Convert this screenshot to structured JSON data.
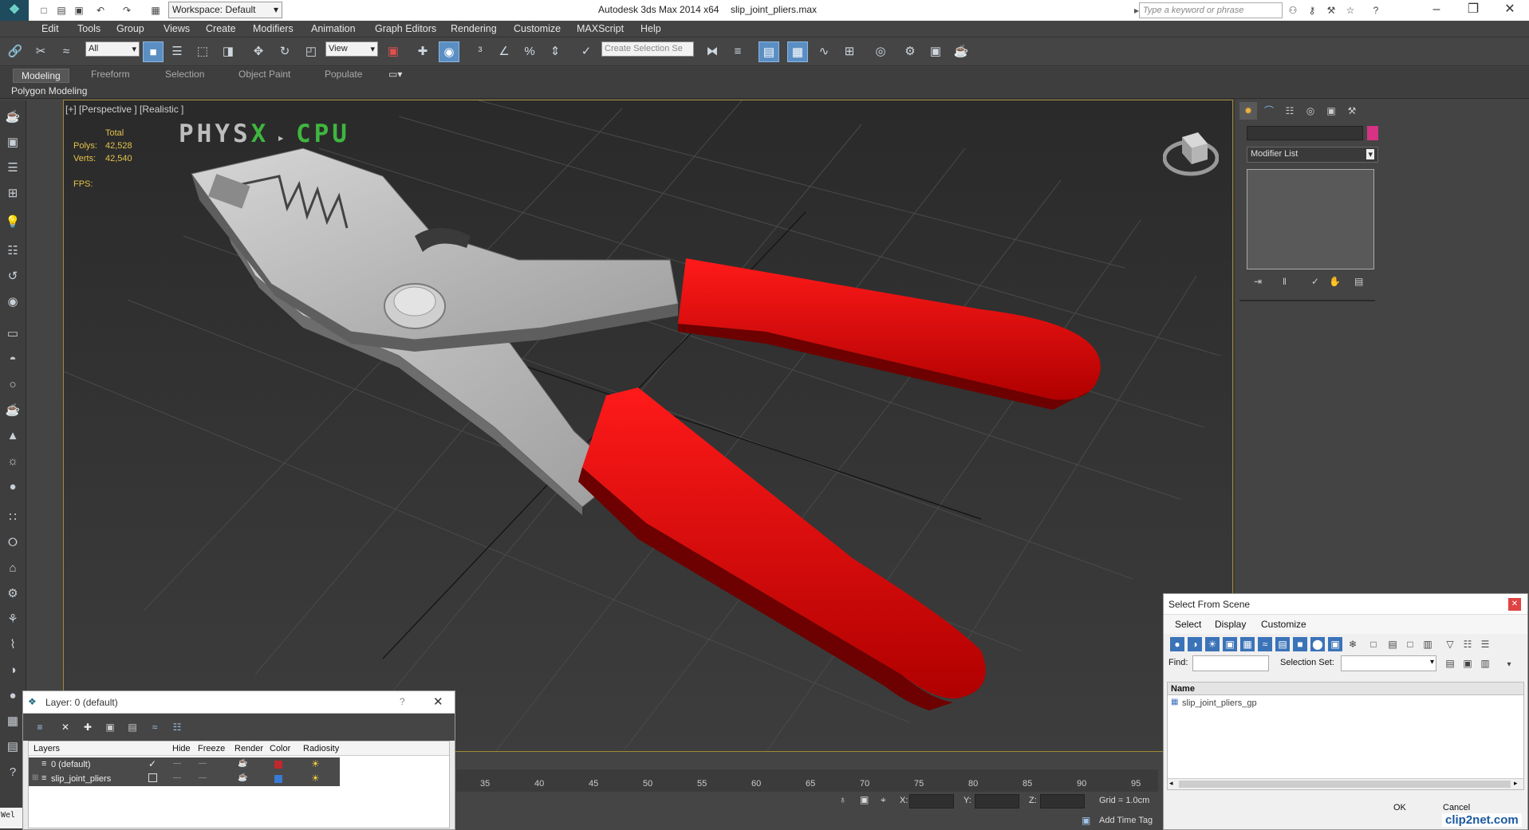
{
  "titlebar": {
    "workspace_label": "Workspace: Default",
    "app_title": "Autodesk 3ds Max  2014 x64",
    "file_name": "slip_joint_pliers.max",
    "search_placeholder": "Type a keyword or phrase"
  },
  "menus": [
    "Edit",
    "Tools",
    "Group",
    "Views",
    "Create",
    "Modifiers",
    "Animation",
    "Graph Editors",
    "Rendering",
    "Customize",
    "MAXScript",
    "Help"
  ],
  "toolbar": {
    "selection_filter": "All",
    "reference_coord": "View",
    "selection_set_placeholder": "Create Selection Se"
  },
  "ribbon": {
    "tabs": [
      "Modeling",
      "Freeform",
      "Selection",
      "Object Paint",
      "Populate"
    ],
    "panel_label": "Polygon Modeling"
  },
  "viewport": {
    "label": "[+] [Perspective ] [Realistic ]",
    "stats_header": "Total",
    "polys_label": "Polys:",
    "polys_value": "42,528",
    "verts_label": "Verts:",
    "verts_value": "42,540",
    "fps_label": "FPS:",
    "physx_text_a": "PHYS",
    "physx_text_b": "X",
    "physx_text_c": "CPU",
    "colors": {
      "handle": "#e30000",
      "metal": "#b9b9b9",
      "grid": "#3a3a3a",
      "physx_green": "#3fb63f"
    }
  },
  "command_panel": {
    "modifier_list": "Modifier List",
    "swatch_color": "#d63384"
  },
  "trackbar": {
    "ticks": [
      "35",
      "40",
      "45",
      "50",
      "55",
      "60",
      "65",
      "70",
      "75",
      "80",
      "85",
      "90",
      "95"
    ]
  },
  "status": {
    "x_label": "X:",
    "y_label": "Y:",
    "z_label": "Z:",
    "grid_label": "Grid = 1.0cm",
    "add_time_tag": "Add Time Tag",
    "script_prompt": "Wel"
  },
  "layer_dialog": {
    "title": "Layer: 0 (default)",
    "help": "?",
    "columns": [
      "Layers",
      "Hide",
      "Freeze",
      "Render",
      "Color",
      "Radiosity"
    ],
    "rows": [
      {
        "name": "0 (default)",
        "color": "#c0272d",
        "active": true
      },
      {
        "name": "slip_joint_pliers",
        "color": "#3a7bd5",
        "active": false
      }
    ]
  },
  "select_from_scene": {
    "title": "Select From Scene",
    "menus": [
      "Select",
      "Display",
      "Customize"
    ],
    "find_label": "Find:",
    "selection_set_label": "Selection Set:",
    "column_name": "Name",
    "items": [
      "slip_joint_pliers_gp"
    ],
    "ok_label": "OK",
    "cancel_label": "Cancel"
  },
  "watermark": "clip2net.com"
}
